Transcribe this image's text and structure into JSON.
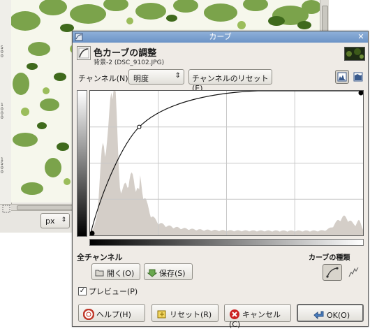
{
  "background_window": {
    "ruler_numbers": [
      "500",
      "1000",
      "1500"
    ],
    "unit_select": "px"
  },
  "dialog": {
    "title": "カーブ",
    "header": {
      "title": "色カーブの調整",
      "subtitle": "背景-2 (DSC_9102.JPG)"
    },
    "channel": {
      "label": "チャンネル(N):",
      "value": "明度",
      "reset_label": "チャンネルのリセット(E)"
    },
    "all_channels_label": "全チャンネル",
    "curve_type_label": "カーブの種類",
    "open_label": "開く(O)",
    "save_label": "保存(S)",
    "preview_label": "プレビュー(P)",
    "preview_checked": true,
    "buttons": {
      "help": "ヘルプ(H)",
      "reset": "リセット(R)",
      "cancel": "キャンセル(C)",
      "ok": "OK(O)"
    },
    "curve_points": [
      [
        0,
        0
      ],
      [
        0.18,
        0.75
      ],
      [
        1,
        1
      ]
    ],
    "colors": {
      "titlebar": "#7aa0cf",
      "histogram": "#d4cec8",
      "cancel_icon": "#cc2222"
    }
  }
}
